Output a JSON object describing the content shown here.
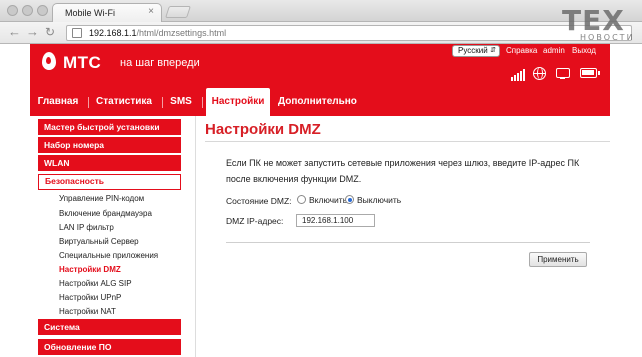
{
  "browser": {
    "tab_title": "Mobile Wi-Fi",
    "tab_close": "×",
    "url_host": "192.168.1.1",
    "url_path": "/html/dmzsettings.html"
  },
  "watermark": {
    "main": "TEX",
    "sub": "НОВОСТИ"
  },
  "header": {
    "logo_text": "МТС",
    "slogan": "на шаг впереди",
    "language": "Русский",
    "help_link": "Справка",
    "user_link": "admin",
    "logout_link": "Выход"
  },
  "main_nav": [
    {
      "label": "Главная"
    },
    {
      "label": "Статистика"
    },
    {
      "label": "SMS"
    },
    {
      "label": "Настройки"
    },
    {
      "label": "Дополнительно"
    }
  ],
  "sidebar": {
    "headers": [
      {
        "label": "Мастер быстрой установки"
      },
      {
        "label": "Набор номера"
      },
      {
        "label": "WLAN"
      },
      {
        "label": "Безопасность"
      },
      {
        "label": "Система"
      },
      {
        "label": "Обновление ПО"
      }
    ],
    "sub_items": [
      {
        "label": "Управление PIN-кодом"
      },
      {
        "label": "Включение брандмауэра"
      },
      {
        "label": "LAN IP фильтр"
      },
      {
        "label": "Виртуальный Сервер"
      },
      {
        "label": "Специальные приложения"
      },
      {
        "label": "Настройки DMZ"
      },
      {
        "label": "Настройки ALG SIP"
      },
      {
        "label": "Настройки UPnP"
      },
      {
        "label": "Настройки NAT"
      }
    ]
  },
  "content": {
    "title": "Настройки DMZ",
    "description": "Если ПК не может запустить сетевые приложения через шлюз, введите IP-адрес ПК после включения функции DMZ.",
    "dmz_status_label": "Состояние DMZ:",
    "option_on": "Включить",
    "option_off": "Выключить",
    "selected_option": "Выключить",
    "dmz_ip_label": "DMZ IP-адрес:",
    "dmz_ip_value": "192.168.1.100",
    "apply_button": "Применить"
  },
  "colors": {
    "brand_red": "#e40d1b",
    "title_red": "#d71f26",
    "radio_blue": "#2a6bd6"
  }
}
